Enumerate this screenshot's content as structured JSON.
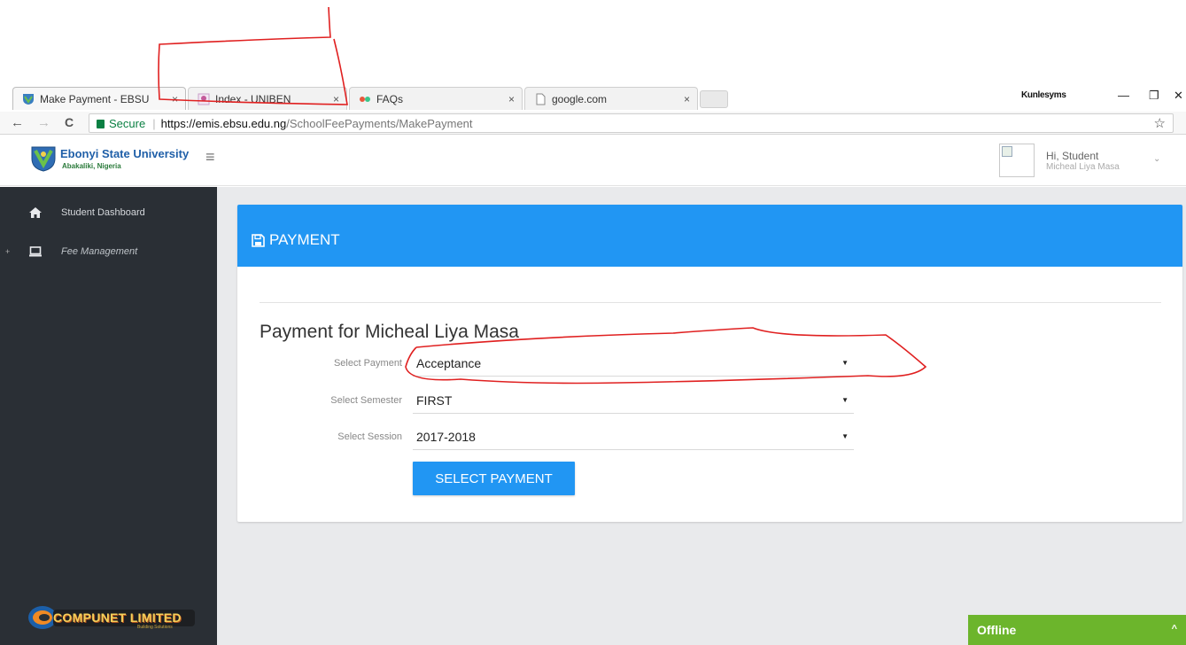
{
  "browser": {
    "tabs": [
      {
        "label": "Make Payment - EBSU",
        "close": "×",
        "active": true,
        "favicon": "ebsu-shield-icon"
      },
      {
        "label": "Index - UNIBEN",
        "close": "×",
        "active": false,
        "favicon": "uniben-icon"
      },
      {
        "label": "FAQs",
        "close": "×",
        "active": false,
        "favicon": "dots-icon"
      },
      {
        "label": "google.com",
        "close": "×",
        "active": false,
        "favicon": "page-icon"
      }
    ],
    "profile_name": "Kunlesyms",
    "window_controls": {
      "minimize": "—",
      "restore": "❐",
      "close": "✕"
    },
    "nav": {
      "back": "←",
      "forward": "→",
      "reload": "C"
    },
    "address": {
      "secure_label": "Secure",
      "scheme_host": "https://emis.ebsu.edu.ng",
      "path": "/SchoolFeePayments/MakePayment"
    },
    "bookmark_star": "☆"
  },
  "header": {
    "university_name": "Ebonyi State University",
    "university_location": "Abakaliki, Nigeria",
    "menu_icon": "≡",
    "greeting": "Hi, Student",
    "user_name": "Micheal Liya Masa",
    "user_chevron": "⌄"
  },
  "sidebar": {
    "items": [
      {
        "label": "Student Dashboard",
        "icon": "home-icon"
      },
      {
        "label": "Fee Management",
        "icon": "laptop-icon",
        "expander": "+"
      }
    ],
    "footer_logo_text": "COMPUNET LIMITED",
    "footer_logo_tagline": "Building Solutions"
  },
  "card": {
    "title": "PAYMENT",
    "heading": "Payment for Micheal Liya Masa",
    "fields": [
      {
        "label": "Select Payment",
        "value": "Acceptance",
        "caret": "▼"
      },
      {
        "label": "Select Semester",
        "value": "FIRST",
        "caret": "▼"
      },
      {
        "label": "Select Session",
        "value": "2017-2018",
        "caret": "▼"
      }
    ],
    "submit_label": "SELECT PAYMENT"
  },
  "chat_widget": {
    "label": "Offline",
    "chevron": "^"
  },
  "colors": {
    "primary": "#2196f3",
    "sidebar_bg": "#2a2f35",
    "content_bg": "#e9eaec",
    "offline_green": "#6cb52c",
    "annotation_red": "#e02020"
  }
}
